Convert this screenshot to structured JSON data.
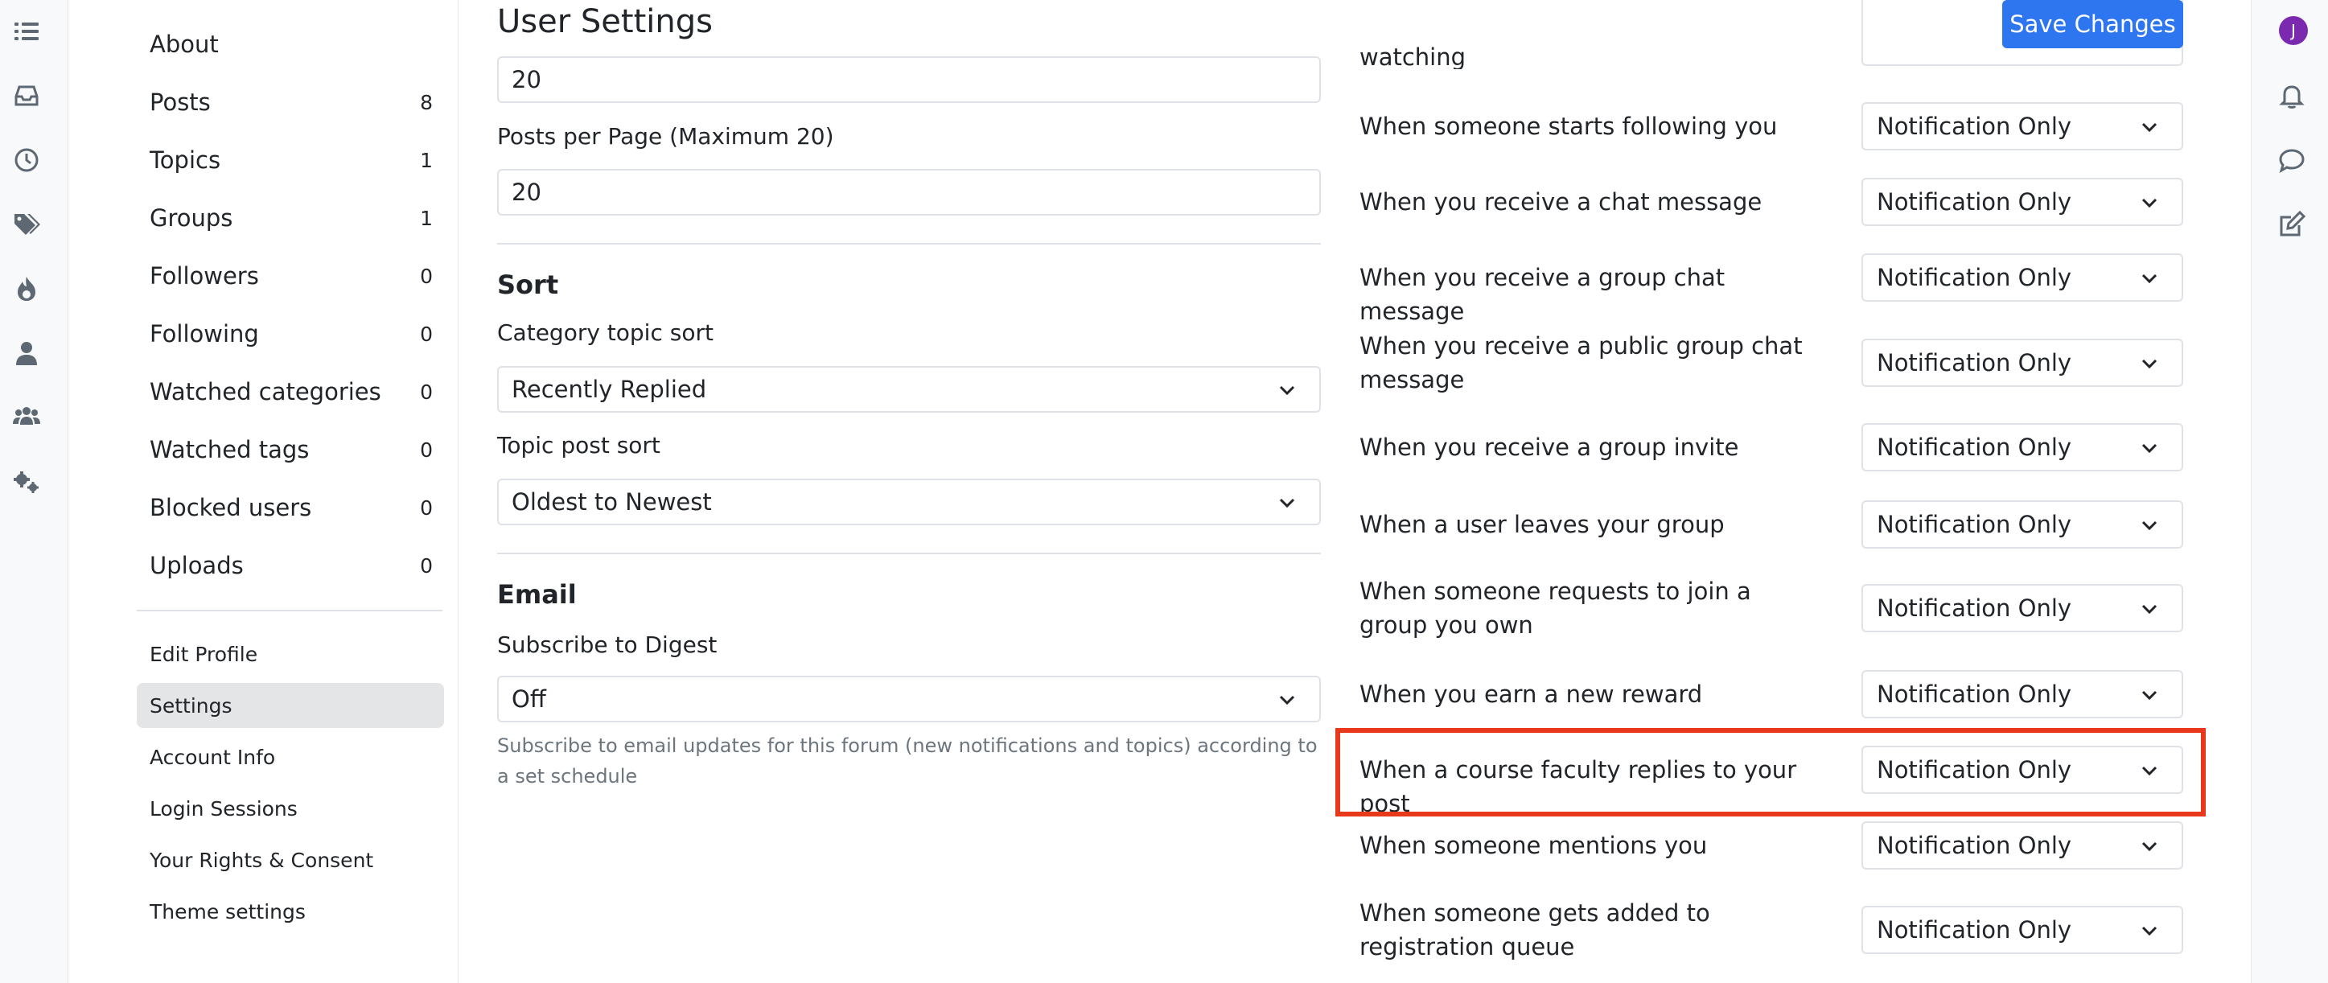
{
  "colors": {
    "accent": "#2e76f0",
    "highlight": "#e8391d",
    "avatar": "#7b2ab0"
  },
  "left_rail": {
    "icons": [
      "list-icon",
      "inbox-icon",
      "clock-icon",
      "tags-icon",
      "fire-icon",
      "user-icon",
      "users-icon",
      "gears-icon"
    ]
  },
  "right_rail": {
    "avatar_letter": "J",
    "icons": [
      "bell-icon",
      "chat-icon",
      "compose-icon"
    ]
  },
  "sidebar": {
    "items": [
      {
        "label": "About",
        "count": ""
      },
      {
        "label": "Posts",
        "count": "8"
      },
      {
        "label": "Topics",
        "count": "1"
      },
      {
        "label": "Groups",
        "count": "1"
      },
      {
        "label": "Followers",
        "count": "0"
      },
      {
        "label": "Following",
        "count": "0"
      },
      {
        "label": "Watched categories",
        "count": "0"
      },
      {
        "label": "Watched tags",
        "count": "0"
      },
      {
        "label": "Blocked users",
        "count": "0"
      },
      {
        "label": "Uploads",
        "count": "0"
      }
    ],
    "links": [
      {
        "label": "Edit Profile",
        "active": false
      },
      {
        "label": "Settings",
        "active": true
      },
      {
        "label": "Account Info",
        "active": false
      },
      {
        "label": "Login Sessions",
        "active": false
      },
      {
        "label": "Your Rights & Consent",
        "active": false
      },
      {
        "label": "Theme settings",
        "active": false
      }
    ]
  },
  "main": {
    "title": "User Settings",
    "save_label": "Save Changes",
    "topics_per_page_value": "20",
    "posts_per_page_label": "Posts per Page (Maximum 20)",
    "posts_per_page_value": "20",
    "sort_title": "Sort",
    "category_sort_label": "Category topic sort",
    "category_sort_value": "Recently Replied",
    "topic_post_sort_label": "Topic post sort",
    "topic_post_sort_value": "Oldest to Newest",
    "email_title": "Email",
    "digest_label": "Subscribe to Digest",
    "digest_value": "Off",
    "digest_help": "Subscribe to email updates for this forum (new notifications and topics) according to a set schedule"
  },
  "notifications": {
    "partial_label": "watching",
    "rows": [
      {
        "label": "When someone starts following you",
        "value": "Notification Only"
      },
      {
        "label": "When you receive a chat message",
        "value": "Notification Only"
      },
      {
        "label": "When you receive a group chat message",
        "value": "Notification Only"
      },
      {
        "label": "When you receive a public group chat message",
        "value": "Notification Only"
      },
      {
        "label": "When you receive a group invite",
        "value": "Notification Only"
      },
      {
        "label": "When a user leaves your group",
        "value": "Notification Only"
      },
      {
        "label": "When someone requests to join a group you own",
        "value": "Notification Only"
      },
      {
        "label": "When you earn a new reward",
        "value": "Notification Only"
      },
      {
        "label": "When a course faculty replies to your post",
        "value": "Notification Only"
      },
      {
        "label": "When someone mentions you",
        "value": "Notification Only"
      },
      {
        "label": "When someone gets added to registration queue",
        "value": "Notification Only"
      }
    ]
  }
}
